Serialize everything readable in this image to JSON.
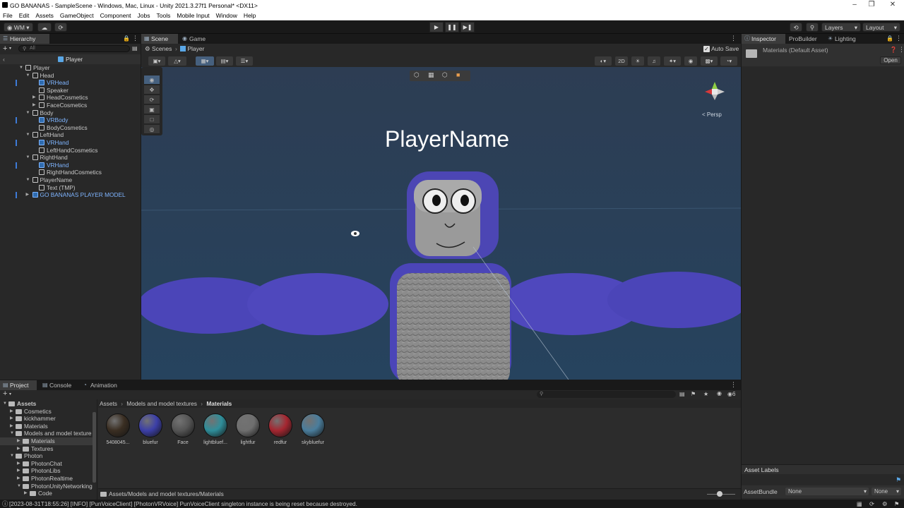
{
  "window": {
    "title": "GO BANANAS - SampleScene - Windows, Mac, Linux - Unity 2021.3.27f1 Personal* <DX11>"
  },
  "menu": [
    "File",
    "Edit",
    "Assets",
    "GameObject",
    "Component",
    "Jobs",
    "Tools",
    "Mobile Input",
    "Window",
    "Help"
  ],
  "toolbar": {
    "account_label": "WM",
    "layers_label": "Layers",
    "layout_label": "Layout"
  },
  "hierarchy": {
    "tab_label": "Hierarchy",
    "search_placeholder": "All",
    "context_label": "Player",
    "rows": [
      {
        "label": "Player",
        "depth": 0,
        "blue": false,
        "expanded": true
      },
      {
        "label": "Head",
        "depth": 1,
        "blue": false,
        "expanded": true
      },
      {
        "label": "VRHead",
        "depth": 2,
        "blue": true,
        "expanded": null
      },
      {
        "label": "Speaker",
        "depth": 2,
        "blue": false,
        "expanded": null
      },
      {
        "label": "HeadCosmetics",
        "depth": 2,
        "blue": false,
        "expanded": false
      },
      {
        "label": "FaceCosmetics",
        "depth": 2,
        "blue": false,
        "expanded": false
      },
      {
        "label": "Body",
        "depth": 1,
        "blue": false,
        "expanded": true
      },
      {
        "label": "VRBody",
        "depth": 2,
        "blue": true,
        "expanded": null
      },
      {
        "label": "BodyCosmetics",
        "depth": 2,
        "blue": false,
        "expanded": null
      },
      {
        "label": "LeftHand",
        "depth": 1,
        "blue": false,
        "expanded": true
      },
      {
        "label": "VRHand",
        "depth": 2,
        "blue": true,
        "expanded": null
      },
      {
        "label": "LeftHandCosmetics",
        "depth": 2,
        "blue": false,
        "expanded": null
      },
      {
        "label": "RightHand",
        "depth": 1,
        "blue": false,
        "expanded": true
      },
      {
        "label": "VRHand",
        "depth": 2,
        "blue": true,
        "expanded": null
      },
      {
        "label": "RightHandCosmetics",
        "depth": 2,
        "blue": false,
        "expanded": null
      },
      {
        "label": "PlayerName",
        "depth": 1,
        "blue": false,
        "expanded": true
      },
      {
        "label": "Text (TMP)",
        "depth": 2,
        "blue": false,
        "expanded": null
      },
      {
        "label": "GO BANANAS PLAYER MODEL",
        "depth": 1,
        "blue": true,
        "expanded": false
      }
    ]
  },
  "scene": {
    "tabs": [
      "Scene",
      "Game"
    ],
    "breadcrumb_root": "Scenes",
    "breadcrumb_current": "Player",
    "auto_save_label": "Auto Save",
    "mode_2d": "2D",
    "persp_label": "< Persp",
    "player_name_text": "PlayerName"
  },
  "inspector": {
    "tabs": [
      "Inspector",
      "ProBuilder",
      "Lighting"
    ],
    "asset_title": "Materials (Default Asset)",
    "open_button": "Open",
    "asset_labels": "Asset Labels",
    "asset_bundle_label": "AssetBundle",
    "asset_bundle_value": "None",
    "asset_variant_value": "None"
  },
  "project": {
    "tabs": [
      "Project",
      "Console",
      "Animation"
    ],
    "breadcrumb": [
      "Assets",
      "Models and model textures",
      "Materials"
    ],
    "hidden_count": "6",
    "tree": [
      {
        "label": "Assets",
        "depth": 0,
        "bold": true,
        "selected": false
      },
      {
        "label": "Cosmetics",
        "depth": 1,
        "bold": false,
        "selected": false
      },
      {
        "label": "kickhammer",
        "depth": 1,
        "bold": false,
        "selected": false
      },
      {
        "label": "Materials",
        "depth": 1,
        "bold": false,
        "selected": false
      },
      {
        "label": "Models and model texture",
        "depth": 1,
        "bold": false,
        "selected": false
      },
      {
        "label": "Materials",
        "depth": 2,
        "bold": false,
        "selected": true
      },
      {
        "label": "Textures",
        "depth": 2,
        "bold": false,
        "selected": false
      },
      {
        "label": "Photon",
        "depth": 1,
        "bold": false,
        "selected": false
      },
      {
        "label": "PhotonChat",
        "depth": 2,
        "bold": false,
        "selected": false
      },
      {
        "label": "PhotonLibs",
        "depth": 2,
        "bold": false,
        "selected": false
      },
      {
        "label": "PhotonRealtime",
        "depth": 2,
        "bold": false,
        "selected": false
      },
      {
        "label": "PhotonUnityNetworking",
        "depth": 2,
        "bold": false,
        "selected": false
      },
      {
        "label": "Code",
        "depth": 3,
        "bold": false,
        "selected": false
      }
    ],
    "materials": [
      {
        "label": "5408045...",
        "color": "#3a2e22"
      },
      {
        "label": "bluefur",
        "color": "#3c3fa8"
      },
      {
        "label": "Face",
        "color": "#555555"
      },
      {
        "label": "lightbluef...",
        "color": "#2f8e9a"
      },
      {
        "label": "lightfur",
        "color": "#6f6f6f"
      },
      {
        "label": "redfur",
        "color": "#a52630"
      },
      {
        "label": "skybluefur",
        "color": "#4a7d9c"
      }
    ],
    "footer_path": "Assets/Models and model textures/Materials"
  },
  "status": {
    "message": "[2023-08-31T18:55:26] [INFO] [PunVoiceClient] [PhotonVRVoice] PunVoiceClient singleton instance is being reset because destroyed."
  },
  "colors": {
    "sky": "#2a3e55",
    "fur": "#4b45b8",
    "body": "#8c8c8c",
    "face": "#9a9a9a",
    "selection_blue": "#7fb5ff"
  }
}
